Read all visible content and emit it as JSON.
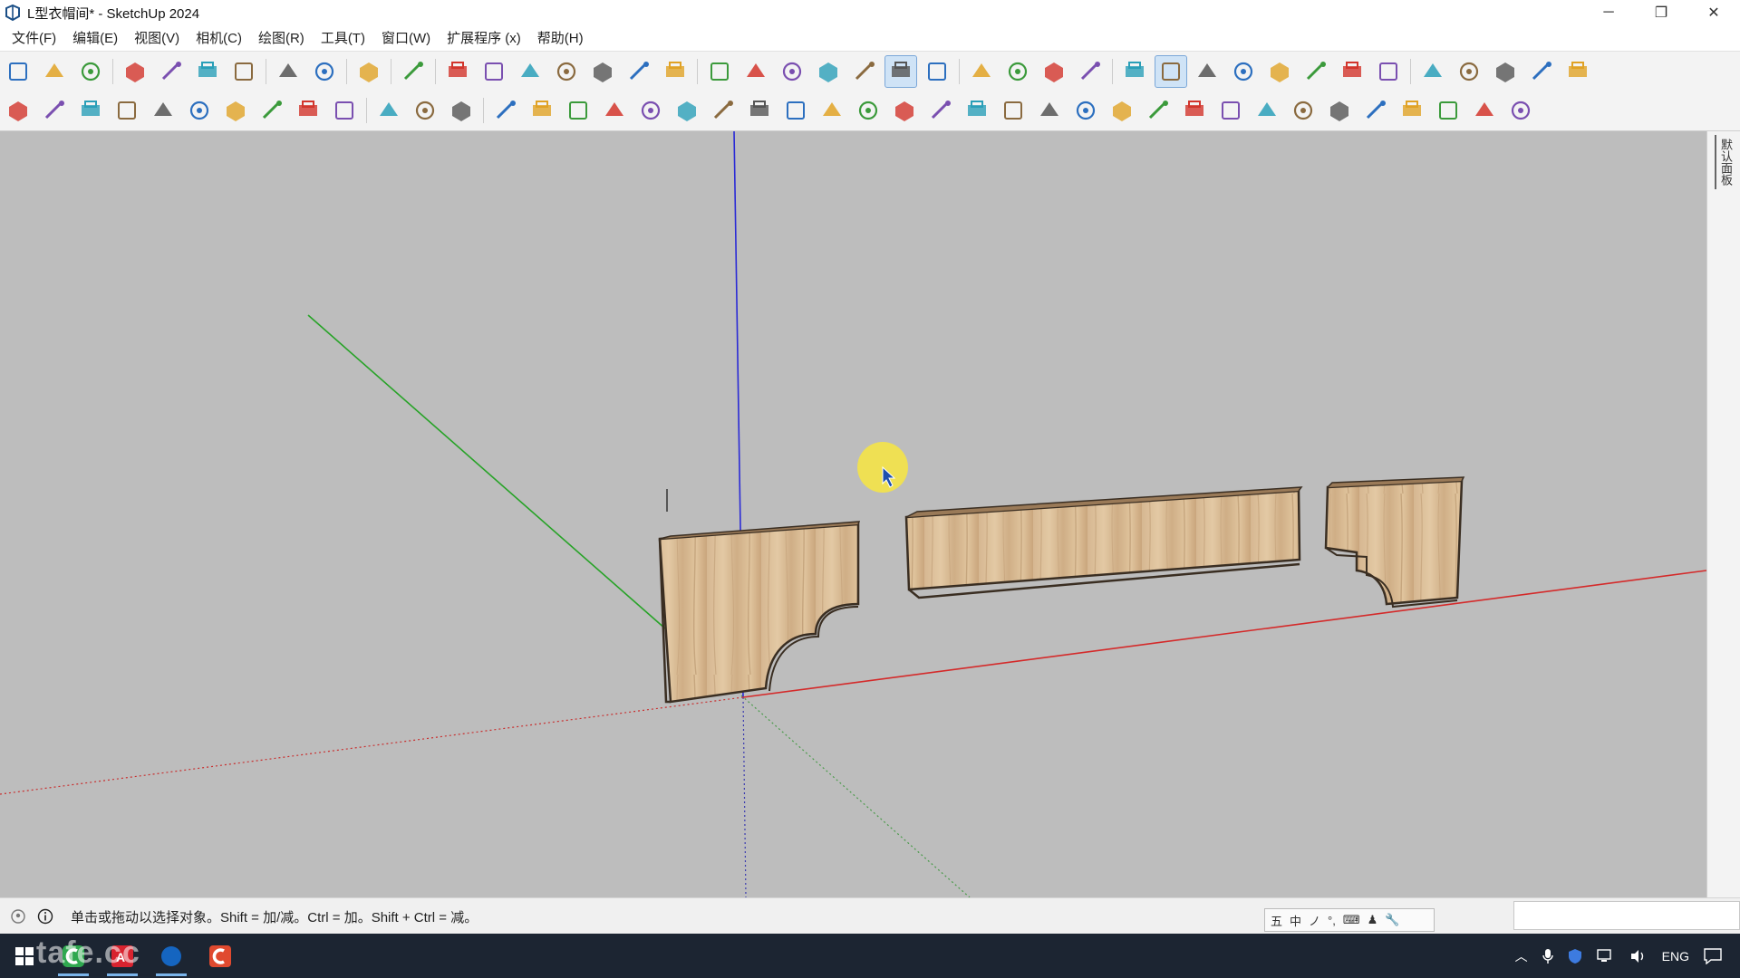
{
  "window": {
    "title": "L型衣帽间* - SketchUp 2024",
    "controls": [
      "─",
      "❐",
      "✕"
    ]
  },
  "menu": [
    "文件(F)",
    "编辑(E)",
    "视图(V)",
    "相机(C)",
    "绘图(R)",
    "工具(T)",
    "窗口(W)",
    "扩展程序 (x)",
    "帮助(H)"
  ],
  "toolbar1": [
    {
      "name": "new-file-icon"
    },
    {
      "name": "open-file-icon"
    },
    {
      "name": "save-icon"
    },
    {
      "sep": true
    },
    {
      "name": "cut-icon"
    },
    {
      "name": "copy-icon"
    },
    {
      "name": "paste-icon"
    },
    {
      "name": "erase-icon"
    },
    {
      "sep": true
    },
    {
      "name": "undo-icon"
    },
    {
      "name": "redo-icon"
    },
    {
      "sep": true
    },
    {
      "name": "print-icon"
    },
    {
      "sep": true
    },
    {
      "name": "model-info-icon"
    },
    {
      "sep": true
    },
    {
      "name": "iso-view-icon"
    },
    {
      "name": "top-view-icon"
    },
    {
      "name": "front-view-icon"
    },
    {
      "name": "right-view-icon"
    },
    {
      "name": "back-view-icon"
    },
    {
      "name": "left-view-icon"
    },
    {
      "name": "bottom-view-icon"
    },
    {
      "sep": true
    },
    {
      "name": "xray-icon"
    },
    {
      "name": "wireframe-icon"
    },
    {
      "name": "hidden-line-icon"
    },
    {
      "name": "shaded-icon"
    },
    {
      "name": "shaded-texture-icon"
    },
    {
      "name": "monochrome-icon",
      "active": true
    },
    {
      "name": "back-edges-icon"
    },
    {
      "sep": true
    },
    {
      "name": "section-plane-icon"
    },
    {
      "name": "section-cut-icon"
    },
    {
      "name": "section-fill-icon"
    },
    {
      "name": "section-display-icon"
    },
    {
      "sep": true
    },
    {
      "name": "warehouse-icon"
    },
    {
      "name": "share-model-icon",
      "active": true
    },
    {
      "name": "extension-warehouse-icon"
    },
    {
      "name": "add-location-icon"
    },
    {
      "name": "terrain-icon"
    },
    {
      "name": "photo-texture-icon"
    },
    {
      "name": "geo-icon"
    },
    {
      "name": "cloud-icon"
    },
    {
      "sep": true
    },
    {
      "name": "extension-manager-icon"
    },
    {
      "name": "layout-icon"
    },
    {
      "name": "info-icon"
    },
    {
      "name": "cart-icon"
    },
    {
      "name": "account-icon"
    }
  ],
  "toolbar2_count": 42,
  "statusbar": {
    "hint": "单击或拖动以选择对象。Shift = 加/减。Ctrl = 加。Shift + Ctrl = 减。",
    "ime": [
      "五",
      "中",
      "ノ",
      "°,",
      "⌨",
      "♟",
      "🔧"
    ]
  },
  "side_panel": {
    "label": "默认面板"
  },
  "taskbar": {
    "watermark": "tafe.cc",
    "tray_lang": "ENG"
  }
}
